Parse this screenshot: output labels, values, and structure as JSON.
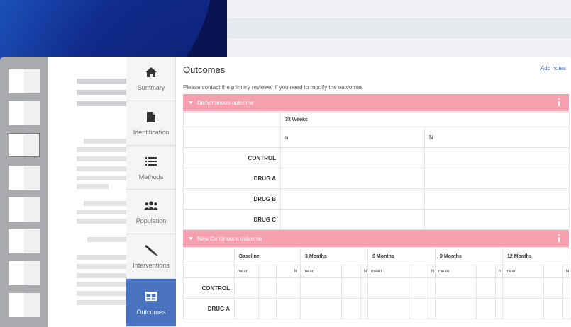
{
  "colors": {
    "accent": "#4a73bf",
    "section_header": "#f4a0af",
    "nav_bg": "#f5f5f5",
    "rail": "#a9abae"
  },
  "tabs": [
    {
      "label": "Summary",
      "icon": "home-icon"
    },
    {
      "label": "Identification",
      "icon": "document-icon"
    },
    {
      "label": "Methods",
      "icon": "list-icon"
    },
    {
      "label": "Population",
      "icon": "people-icon"
    },
    {
      "label": "Interventions",
      "icon": "syringe-icon"
    },
    {
      "label": "Outcomes",
      "icon": "table-icon",
      "active": true
    }
  ],
  "page": {
    "title": "Outcomes",
    "add_notes": "Add notes",
    "note": "Please contact the primary reviewer if you need to modify the outcomes"
  },
  "dichotomous": {
    "header": "Dichotomous outcome",
    "timepoint": "33 Weeks",
    "col_n_lower": "n",
    "col_n_upper": "N",
    "rows": [
      "CONTROL",
      "DRUG A",
      "DRUG B",
      "DRUG C"
    ]
  },
  "continuous": {
    "header": "New Continuous outcome",
    "timepoints": [
      "Baseline",
      "3 Months",
      "6 Months",
      "9 Months",
      "12 Months"
    ],
    "sub_mean": "mean",
    "sub_n": "N",
    "rows": [
      "CONTROL",
      "DRUG A"
    ]
  }
}
